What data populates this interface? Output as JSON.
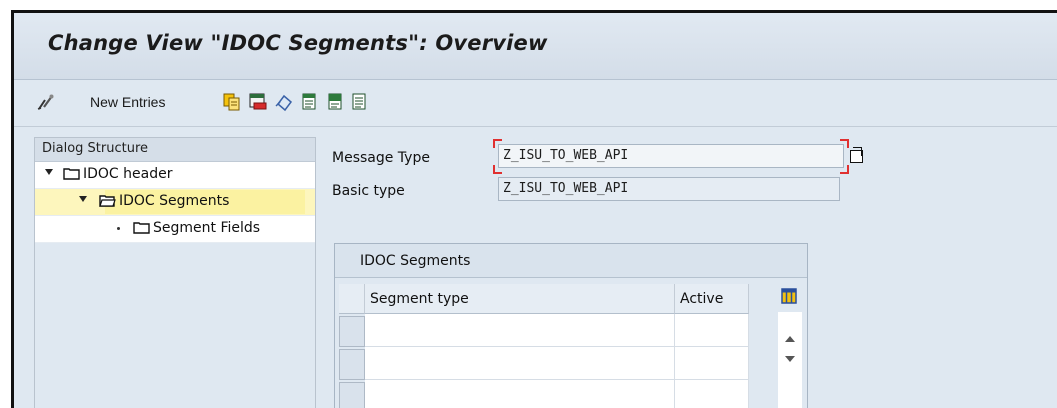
{
  "window": {
    "title": "Change View \"IDOC Segments\": Overview"
  },
  "toolbar": {
    "new_entries_label": "New Entries",
    "icons": [
      "display-change-icon",
      "copy-icon",
      "delete-icon",
      "undo-icon",
      "select-all-icon",
      "select-block-icon",
      "deselect-all-icon"
    ]
  },
  "dialog_structure": {
    "header": "Dialog Structure",
    "items": [
      {
        "label": "IDOC header",
        "level": 0,
        "expanded": true
      },
      {
        "label": "IDOC Segments",
        "level": 1,
        "expanded": true,
        "selected": true
      },
      {
        "label": "Segment Fields",
        "level": 2,
        "expanded": false
      }
    ]
  },
  "form": {
    "message_type_label": "Message Type",
    "message_type_value": "Z_ISU_TO_WEB_API",
    "basic_type_label": "Basic type",
    "basic_type_value": "Z_ISU_TO_WEB_API"
  },
  "table": {
    "title": "IDOC Segments",
    "columns": [
      "Segment type",
      "Active"
    ],
    "rows": [
      {
        "segment_type": "",
        "active": ""
      },
      {
        "segment_type": "",
        "active": ""
      },
      {
        "segment_type": "",
        "active": ""
      }
    ]
  },
  "colors": {
    "background": "#dfe8f1",
    "selected_row": "#fdf6bd",
    "required_marker": "#e03030"
  }
}
